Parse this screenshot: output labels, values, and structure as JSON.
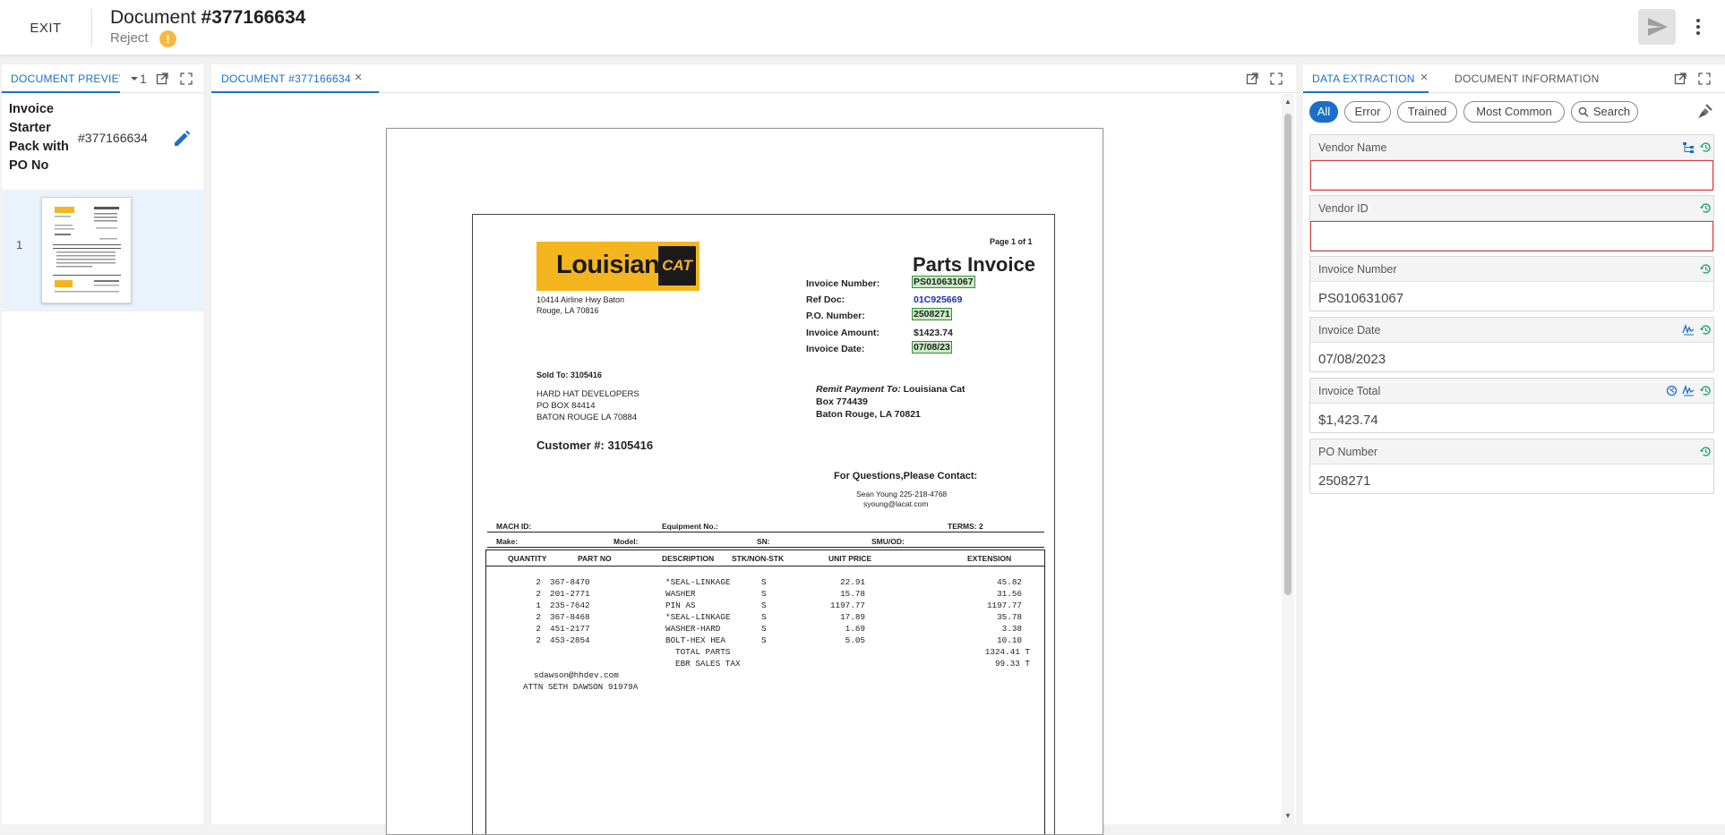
{
  "header": {
    "exit_label": "EXIT",
    "title_prefix": "Document ",
    "title_number": "#377166634",
    "status": "Reject",
    "warn_glyph": "!"
  },
  "left_panel": {
    "tab_label": "DOCUMENT PREVIEW",
    "page_count": "1",
    "doc_name": "Invoice Starter Pack with PO No",
    "doc_number": "#377166634",
    "pages": [
      {
        "number": "1"
      }
    ]
  },
  "middle_panel": {
    "tab_label": "DOCUMENT #377166634"
  },
  "invoice": {
    "logo_text": "Louisiana",
    "logo_mark": "CAT",
    "page_of": "Page 1 of 1",
    "doc_type": "Parts Invoice",
    "address_1": "10414 Airline Hwy Baton",
    "address_2": "Rouge, LA 70816",
    "invoice_number_label": "Invoice Number:",
    "invoice_number": "PS010631067",
    "ref_doc_label": "Ref Doc:",
    "ref_doc": "01C925669",
    "po_label": "P.O. Number:",
    "po_number": "2508271",
    "amount_label": "Invoice Amount:",
    "amount": "$1423.74",
    "date_label": "Invoice Date:",
    "date": "07/08/23",
    "sold_to_label": "Sold To:",
    "sold_to": "3105416",
    "buyer_1": "HARD HAT DEVELOPERS",
    "buyer_2": "PO BOX 84414",
    "buyer_3": "BATON ROUGE LA 70884",
    "remit_label": "Remit Payment To:",
    "remit_name": "Louisiana Cat",
    "remit_box": "Box 774439",
    "remit_city": "Baton Rouge, LA 70821",
    "customer_label": "Customer #:",
    "customer_no": "3105416",
    "questions": "For Questions,Please Contact:",
    "contact_name": "Sean Young 225-218-4768",
    "contact_email": "syoung@lacat.com",
    "mach_id": "MACH ID:",
    "equipment": "Equipment No.:",
    "terms_label": "TERMS:",
    "terms": "2",
    "make": "Make:",
    "model": "Model:",
    "sn": "SN:",
    "smu": "SMU/OD:",
    "columns": [
      "QUANTITY",
      "PART NO",
      "DESCRIPTION",
      "STK/NON-STK",
      "UNIT PRICE",
      "EXTENSION"
    ],
    "rows": [
      {
        "qty": "2",
        "part": "367-8470",
        "desc": "*SEAL-LINKAGE",
        "stk": "S",
        "price": "22.91",
        "ext": "45.82"
      },
      {
        "qty": "2",
        "part": "201-2771",
        "desc": "WASHER",
        "stk": "S",
        "price": "15.78",
        "ext": "31.56"
      },
      {
        "qty": "1",
        "part": "235-7642",
        "desc": "PIN AS",
        "stk": "S",
        "price": "1197.77",
        "ext": "1197.77"
      },
      {
        "qty": "2",
        "part": "367-8468",
        "desc": "*SEAL-LINKAGE",
        "stk": "S",
        "price": "17.89",
        "ext": "35.78"
      },
      {
        "qty": "2",
        "part": "451-2177",
        "desc": "WASHER-HARD",
        "stk": "S",
        "price": "1.69",
        "ext": "3.38"
      },
      {
        "qty": "2",
        "part": "453-2854",
        "desc": "BOLT-HEX HEA",
        "stk": "S",
        "price": "5.05",
        "ext": "10.10"
      }
    ],
    "total_parts_label": "TOTAL PARTS",
    "total_parts": "1324.41 T",
    "tax_label": "EBR SALES TAX",
    "tax": "99.33 T",
    "note_email": "sdawson@hhdev.com",
    "note_attn": "ATTN SETH DAWSON 91979A"
  },
  "right_panel": {
    "tab_extraction": "DATA EXTRACTION",
    "tab_info": "DOCUMENT INFORMATION",
    "filters": [
      "All",
      "Error",
      "Trained",
      "Most Common",
      "Search"
    ],
    "fields": [
      {
        "label": "Vendor Name",
        "value": ""
      },
      {
        "label": "Vendor ID",
        "value": ""
      },
      {
        "label": "Invoice Number",
        "value": "PS010631067"
      },
      {
        "label": "Invoice Date",
        "value": "07/08/2023"
      },
      {
        "label": "Invoice Total",
        "value": "$1,423.74"
      },
      {
        "label": "PO Number",
        "value": "2508271"
      }
    ]
  },
  "colors": {
    "accent": "#1a6fc9",
    "error": "#e03a3a",
    "warn": "#f5b942",
    "history": "#1aa37a",
    "highlight": "#c9eec4"
  },
  "icons": [
    "send-icon",
    "more-vert-icon",
    "chevron-down-icon",
    "open-external-icon",
    "fullscreen-icon",
    "close-icon",
    "edit-icon",
    "search-icon",
    "broom-icon",
    "tree-icon",
    "history-icon",
    "signature-icon",
    "refresh-icon"
  ]
}
